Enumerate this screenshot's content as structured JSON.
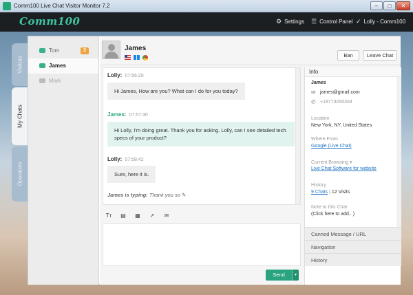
{
  "window": {
    "title": "Comm100 Live Chat Visitor Monitor 7.2",
    "minimize": "–",
    "maximize": "□",
    "close": "✕"
  },
  "header": {
    "logo": "Comm100",
    "settings_label": "Settings",
    "control_panel_label": "Control Panel",
    "user_label": "Lolly - Comm100"
  },
  "side_tabs": [
    "Visitors",
    "My Chats",
    "Operators"
  ],
  "chat_list": [
    {
      "name": "Tom",
      "badge": "3"
    },
    {
      "name": "James"
    },
    {
      "name": "Mark"
    }
  ],
  "visitor": {
    "name": "James",
    "ban_label": "Ban",
    "leave_label": "Leave Chat"
  },
  "messages": [
    {
      "sender": "Lolly:",
      "time": "07:56:20",
      "text": "Hi James, How are you? What can I do for you today?"
    },
    {
      "sender": "James:",
      "time": "07:57:30",
      "text_line1": "Hi Lolly, I'm doing great. Thank you for asking. Lolly, can I see detailed tech",
      "text_line2": "specs of your product?"
    },
    {
      "sender": "Lolly:",
      "time": "07:58:42",
      "text": "Sure, here it is."
    }
  ],
  "typing": {
    "who": "James is typing:",
    "preview": "Thank you so"
  },
  "composer": {
    "send_label": "Send",
    "send_dropdown": "▾"
  },
  "info": {
    "title": "Info",
    "name": "James",
    "email": "james@gmail.com",
    "phone": "+18773050464",
    "location_label": "Location",
    "location": "New York, NY, United States",
    "where_from_label": "Where From",
    "where_from": "Google (Live Chat)",
    "browsing_label": "Current Browsing",
    "browsing": "Live Chat Software for website",
    "history_label": "History",
    "history_chats": "9 Chats",
    "history_sep": "|",
    "history_visits": "12 Visits",
    "note_label": "Note to this Chat",
    "note": "(Click here to add...)"
  },
  "accordion": [
    "Canned Message / URL",
    "Navigation",
    "History"
  ]
}
